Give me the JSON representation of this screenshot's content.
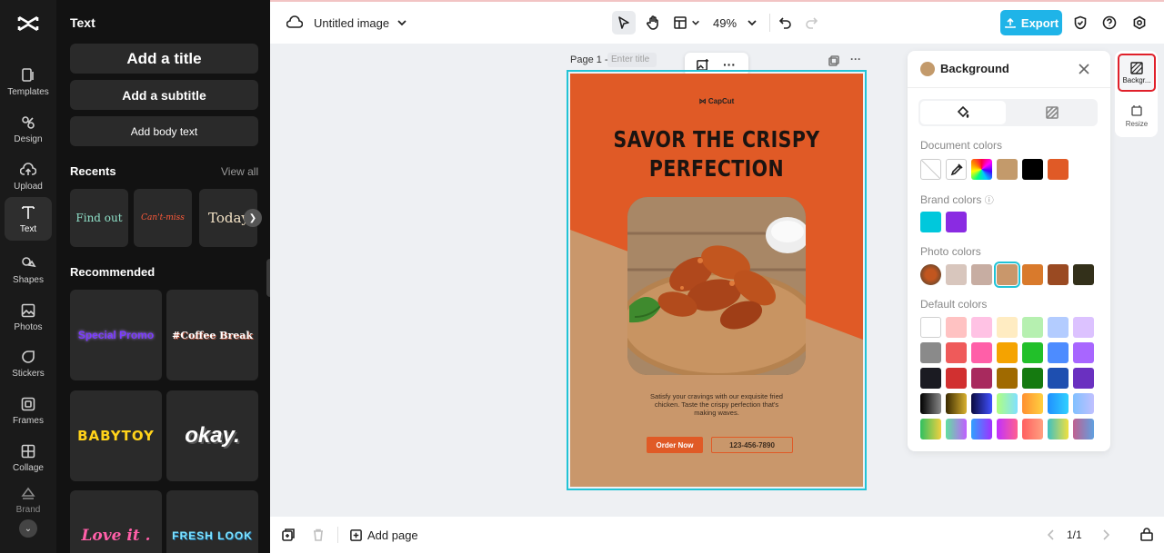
{
  "panel": {
    "title": "Text",
    "add_title": "Add a title",
    "add_subtitle": "Add a subtitle",
    "add_body": "Add body text",
    "recents_title": "Recents",
    "view_all": "View all",
    "recents": [
      "Find out",
      "Can't-miss",
      "Today"
    ],
    "recommended_title": "Recommended",
    "recommended": [
      "Special Promo",
      "#Coffee Break",
      "BABYTOY",
      "okay.",
      "Love it .",
      "FRESH LOOK"
    ]
  },
  "rail": {
    "items": [
      "Templates",
      "Design",
      "Upload",
      "Text",
      "Shapes",
      "Photos",
      "Stickers",
      "Frames",
      "Collage",
      "Brand"
    ]
  },
  "topbar": {
    "doc_name": "Untitled image",
    "zoom": "49%",
    "export_label": "Export"
  },
  "page": {
    "label": "Page 1 -",
    "title_placeholder": "Enter title"
  },
  "poster": {
    "brand": "CapCut",
    "headline_1": "SAVOR THE CRISPY",
    "headline_2": "PERFECTION",
    "body": "Satisfy your cravings with our exquisite fried chicken. Taste the crispy perfection that's making waves.",
    "order_btn": "Order Now",
    "phone": "123-456-7890",
    "colors": {
      "orange": "#e05a26",
      "tan": "#c9976b"
    }
  },
  "background_panel": {
    "title": "Background",
    "document_colors_label": "Document colors",
    "brand_colors_label": "Brand colors",
    "photo_colors_label": "Photo colors",
    "default_colors_label": "Default colors",
    "document_colors": [
      "#c39a6b",
      "#000000",
      "#e05a26"
    ],
    "brand_colors": [
      "#00c8dc",
      "#8a2be2"
    ],
    "photo_colors": [
      "#d8c6bd",
      "#c7ada2",
      "#c9976b",
      "#d97a2c",
      "#9a4a22",
      "#33301a"
    ]
  },
  "right_strip": {
    "background_label": "Backgr...",
    "resize_label": "Resize"
  },
  "bottombar": {
    "add_page": "Add page",
    "page_count": "1/1"
  }
}
